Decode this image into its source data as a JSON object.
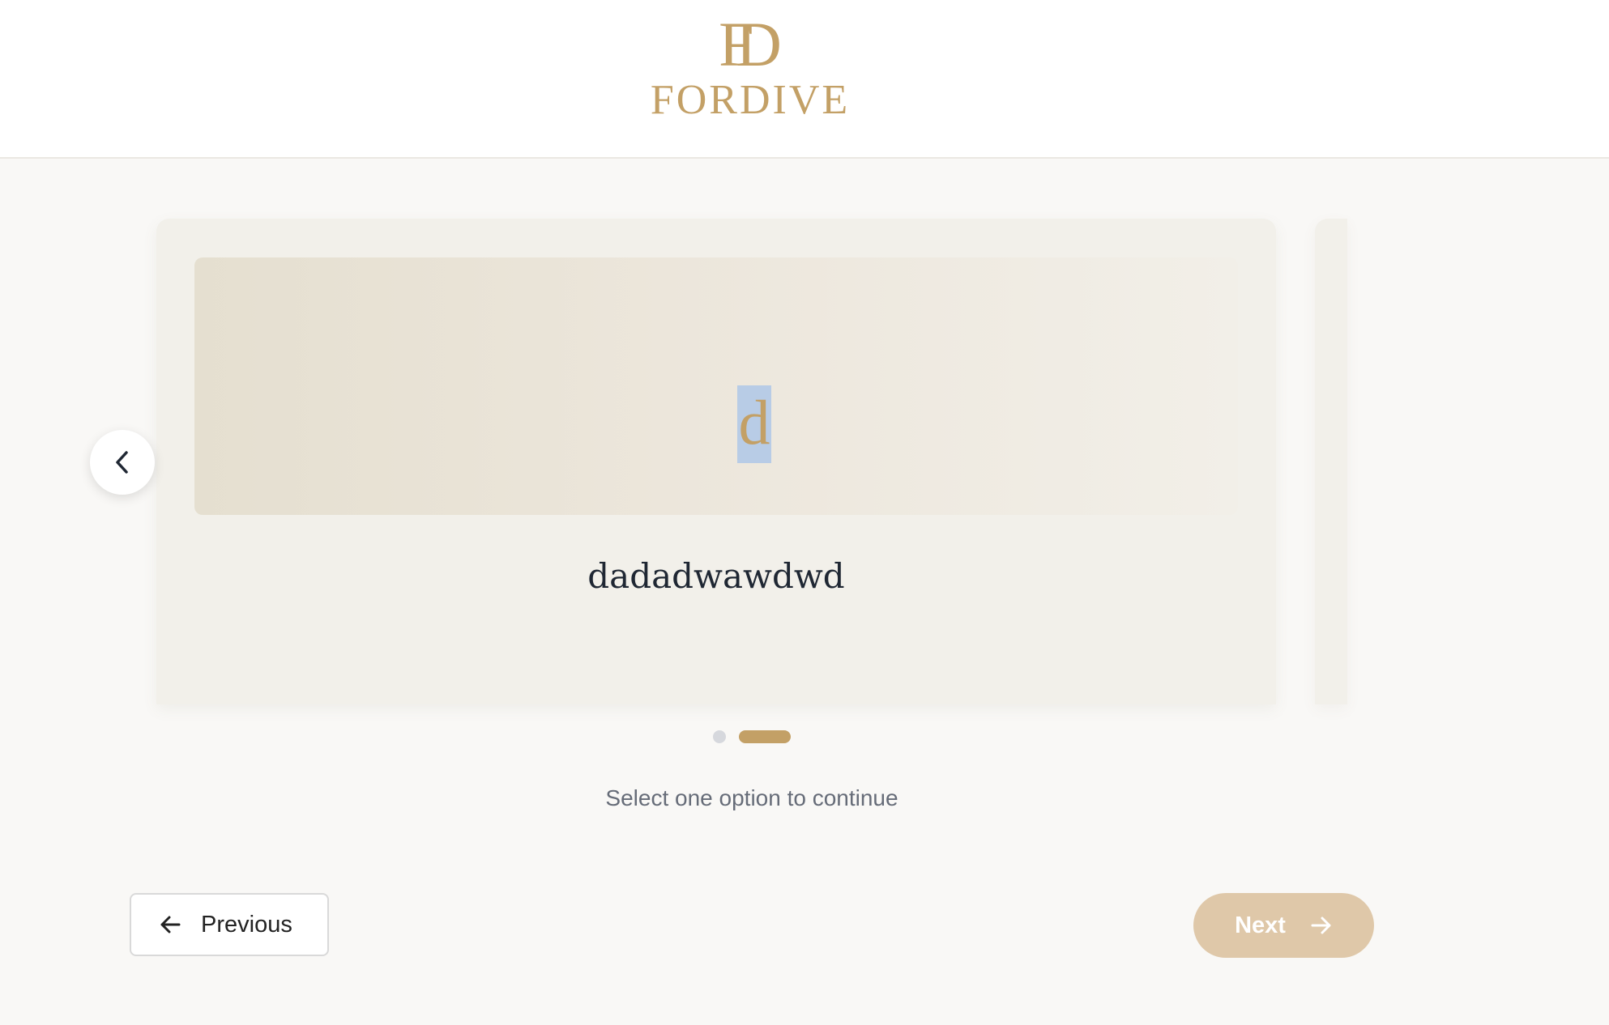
{
  "brand": {
    "logo_mark": "FD",
    "logo_text": "FORDIVE",
    "color": "#c3a066"
  },
  "carousel": {
    "card": {
      "initial": "d",
      "title": "dadadwawdwd"
    },
    "current_index": 2,
    "total": 2,
    "prev_icon": "chevron-left-icon"
  },
  "hint": "Select one option to continue",
  "navigation": {
    "previous_label": "Previous",
    "previous_icon": "arrow-left-icon",
    "next_label": "Next",
    "next_icon": "arrow-right-icon",
    "next_color": "#dfc8a9"
  }
}
